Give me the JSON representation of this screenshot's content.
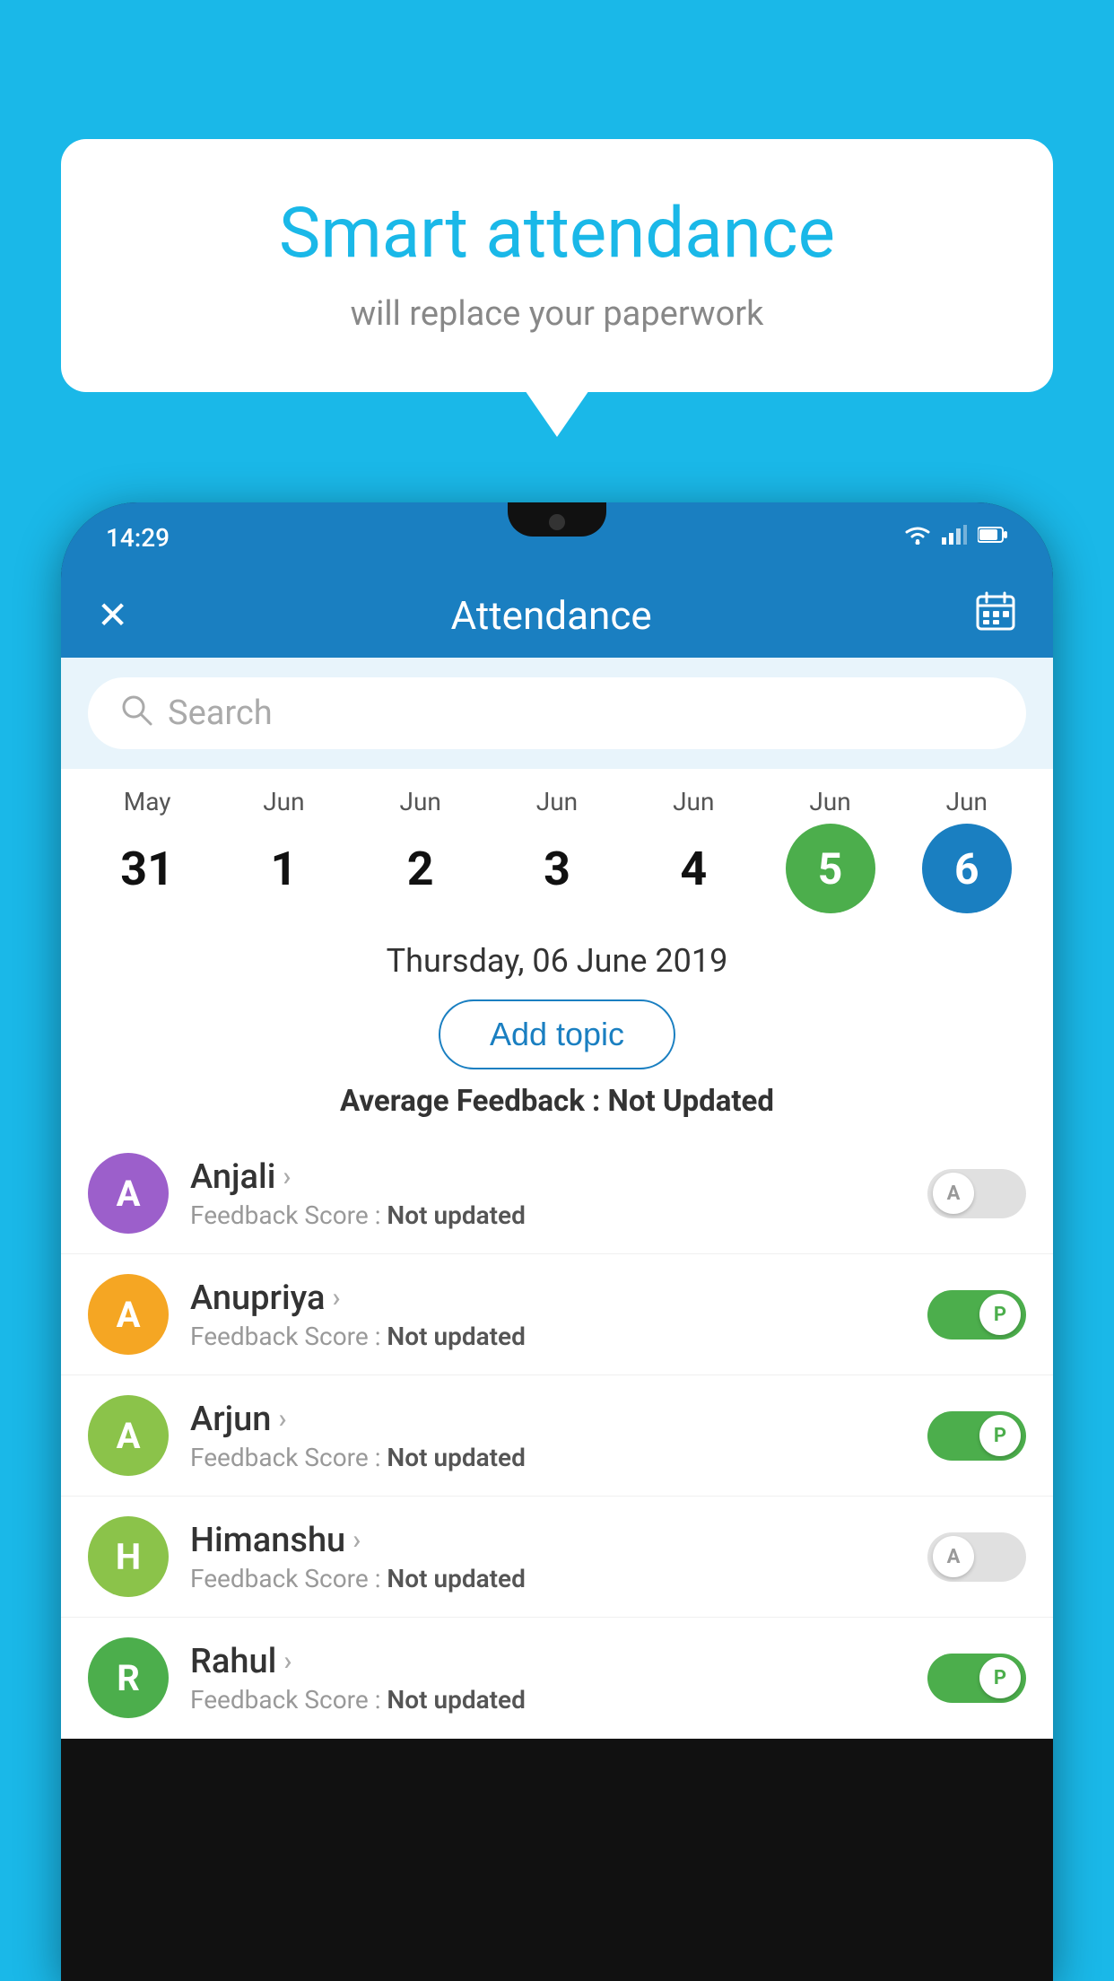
{
  "background_color": "#1ab8e8",
  "speech_bubble": {
    "title": "Smart attendance",
    "subtitle": "will replace your paperwork"
  },
  "status_bar": {
    "time": "14:29",
    "icons": [
      "wifi",
      "signal",
      "battery"
    ]
  },
  "header": {
    "title": "Attendance",
    "close_label": "✕",
    "calendar_icon": "📅"
  },
  "search": {
    "placeholder": "Search"
  },
  "calendar": {
    "days": [
      {
        "month": "May",
        "day": "31",
        "state": "normal"
      },
      {
        "month": "Jun",
        "day": "1",
        "state": "normal"
      },
      {
        "month": "Jun",
        "day": "2",
        "state": "normal"
      },
      {
        "month": "Jun",
        "day": "3",
        "state": "normal"
      },
      {
        "month": "Jun",
        "day": "4",
        "state": "normal"
      },
      {
        "month": "Jun",
        "day": "5",
        "state": "today"
      },
      {
        "month": "Jun",
        "day": "6",
        "state": "selected"
      }
    ]
  },
  "selected_date": "Thursday, 06 June 2019",
  "add_topic_label": "Add topic",
  "avg_feedback_label": "Average Feedback :",
  "avg_feedback_value": "Not Updated",
  "students": [
    {
      "name": "Anjali",
      "avatar_letter": "A",
      "avatar_color": "#9c5fcb",
      "feedback_label": "Feedback Score :",
      "feedback_value": "Not updated",
      "toggle": "off",
      "toggle_letter": "A"
    },
    {
      "name": "Anupriya",
      "avatar_letter": "A",
      "avatar_color": "#f5a623",
      "feedback_label": "Feedback Score :",
      "feedback_value": "Not updated",
      "toggle": "on",
      "toggle_letter": "P"
    },
    {
      "name": "Arjun",
      "avatar_letter": "A",
      "avatar_color": "#8bc34a",
      "feedback_label": "Feedback Score :",
      "feedback_value": "Not updated",
      "toggle": "on",
      "toggle_letter": "P"
    },
    {
      "name": "Himanshu",
      "avatar_letter": "H",
      "avatar_color": "#8bc34a",
      "feedback_label": "Feedback Score :",
      "feedback_value": "Not updated",
      "toggle": "off",
      "toggle_letter": "A"
    },
    {
      "name": "Rahul",
      "avatar_letter": "R",
      "avatar_color": "#4cae4c",
      "feedback_label": "Feedback Score :",
      "feedback_value": "Not updated",
      "toggle": "on",
      "toggle_letter": "P"
    }
  ]
}
